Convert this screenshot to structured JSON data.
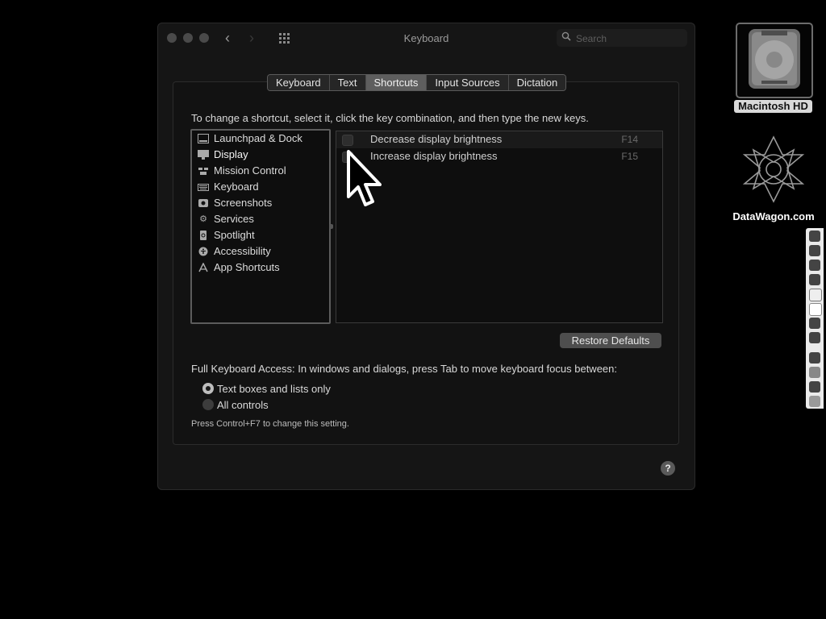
{
  "window": {
    "title": "Keyboard",
    "search_placeholder": "Search"
  },
  "tabs": [
    {
      "label": "Keyboard",
      "active": false
    },
    {
      "label": "Text",
      "active": false
    },
    {
      "label": "Shortcuts",
      "active": true
    },
    {
      "label": "Input Sources",
      "active": false
    },
    {
      "label": "Dictation",
      "active": false
    }
  ],
  "instruction": "To change a shortcut, select it, click the key combination, and then type the new keys.",
  "categories": [
    {
      "label": "Launchpad & Dock",
      "icon": "launchpad-dock-icon",
      "selected": false
    },
    {
      "label": "Display",
      "icon": "display-icon",
      "selected": true
    },
    {
      "label": "Mission Control",
      "icon": "mission-control-icon",
      "selected": false
    },
    {
      "label": "Keyboard",
      "icon": "keyboard-icon",
      "selected": false
    },
    {
      "label": "Screenshots",
      "icon": "screenshots-icon",
      "selected": false
    },
    {
      "label": "Services",
      "icon": "services-gear-icon",
      "selected": false
    },
    {
      "label": "Spotlight",
      "icon": "spotlight-icon",
      "selected": false
    },
    {
      "label": "Accessibility",
      "icon": "accessibility-icon",
      "selected": false
    },
    {
      "label": "App Shortcuts",
      "icon": "app-shortcuts-icon",
      "selected": false
    }
  ],
  "shortcuts": [
    {
      "label": "Decrease display brightness",
      "key": "F14",
      "checked": false
    },
    {
      "label": "Increase display brightness",
      "key": "F15",
      "checked": false
    }
  ],
  "restore_defaults": "Restore Defaults",
  "full_keyboard_access": {
    "label": "Full Keyboard Access: In windows and dialogs, press Tab to move keyboard focus between:",
    "options": [
      {
        "label": "Text boxes and lists only",
        "selected": true
      },
      {
        "label": "All controls",
        "selected": false
      }
    ],
    "hint": "Press Control+F7 to change this setting."
  },
  "help": "?",
  "desktop": {
    "drive_label": "Macintosh HD",
    "logo_label": "DataWagon.com",
    "dock_icons": [
      "finder-icon",
      "safari-icon",
      "chrome-icon",
      "compass-icon",
      "calendar-icon",
      "notes-icon",
      "app-store-icon",
      "time-machine-icon",
      "app-store-alt-icon",
      "image-preview-icon",
      "printer-icon",
      "trash-icon"
    ]
  }
}
